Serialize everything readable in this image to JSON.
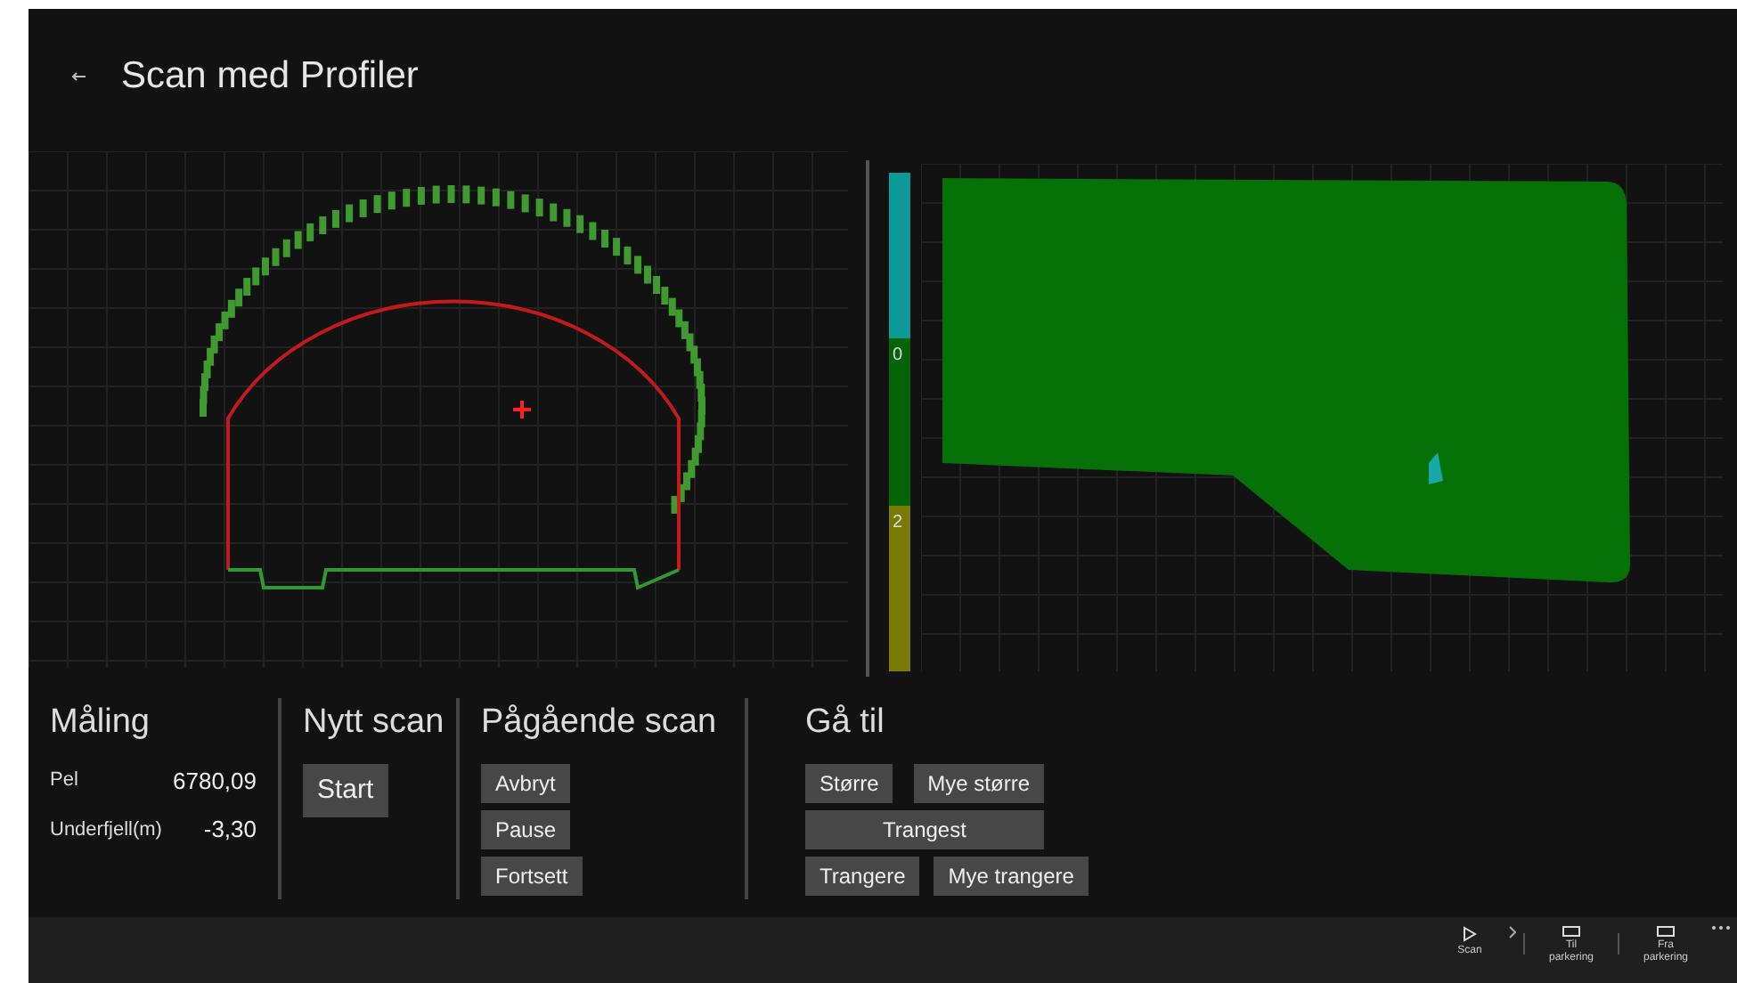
{
  "page": {
    "title": "Scan med Profiler"
  },
  "legend": [
    {
      "color": "#0e9999"
    },
    {
      "label": "0",
      "color": "#056405"
    },
    {
      "label": "2",
      "color": "#7a7a06"
    }
  ],
  "measurement": {
    "title": "Måling",
    "rows": [
      {
        "label": "Pel",
        "value": "6780,09"
      },
      {
        "label": "Underfjell(m)",
        "value": "-3,30"
      }
    ]
  },
  "new_scan": {
    "title": "Nytt scan",
    "buttons": [
      "Start"
    ]
  },
  "ongoing_scan": {
    "title": "Pågående scan",
    "buttons": [
      "Avbryt",
      "Pause",
      "Fortsett"
    ]
  },
  "goto": {
    "title": "Gå til",
    "rows": [
      [
        "Større",
        "Mye større"
      ],
      [
        "Trangest"
      ],
      [
        "Trangere",
        "Mye trangere"
      ]
    ]
  },
  "app_bar": {
    "buttons": [
      {
        "kind": "play",
        "label": "Scan"
      },
      {
        "kind": "rect",
        "label": "Til\nparkering"
      },
      {
        "kind": "rect",
        "label": "Fra\nparkering"
      }
    ]
  }
}
